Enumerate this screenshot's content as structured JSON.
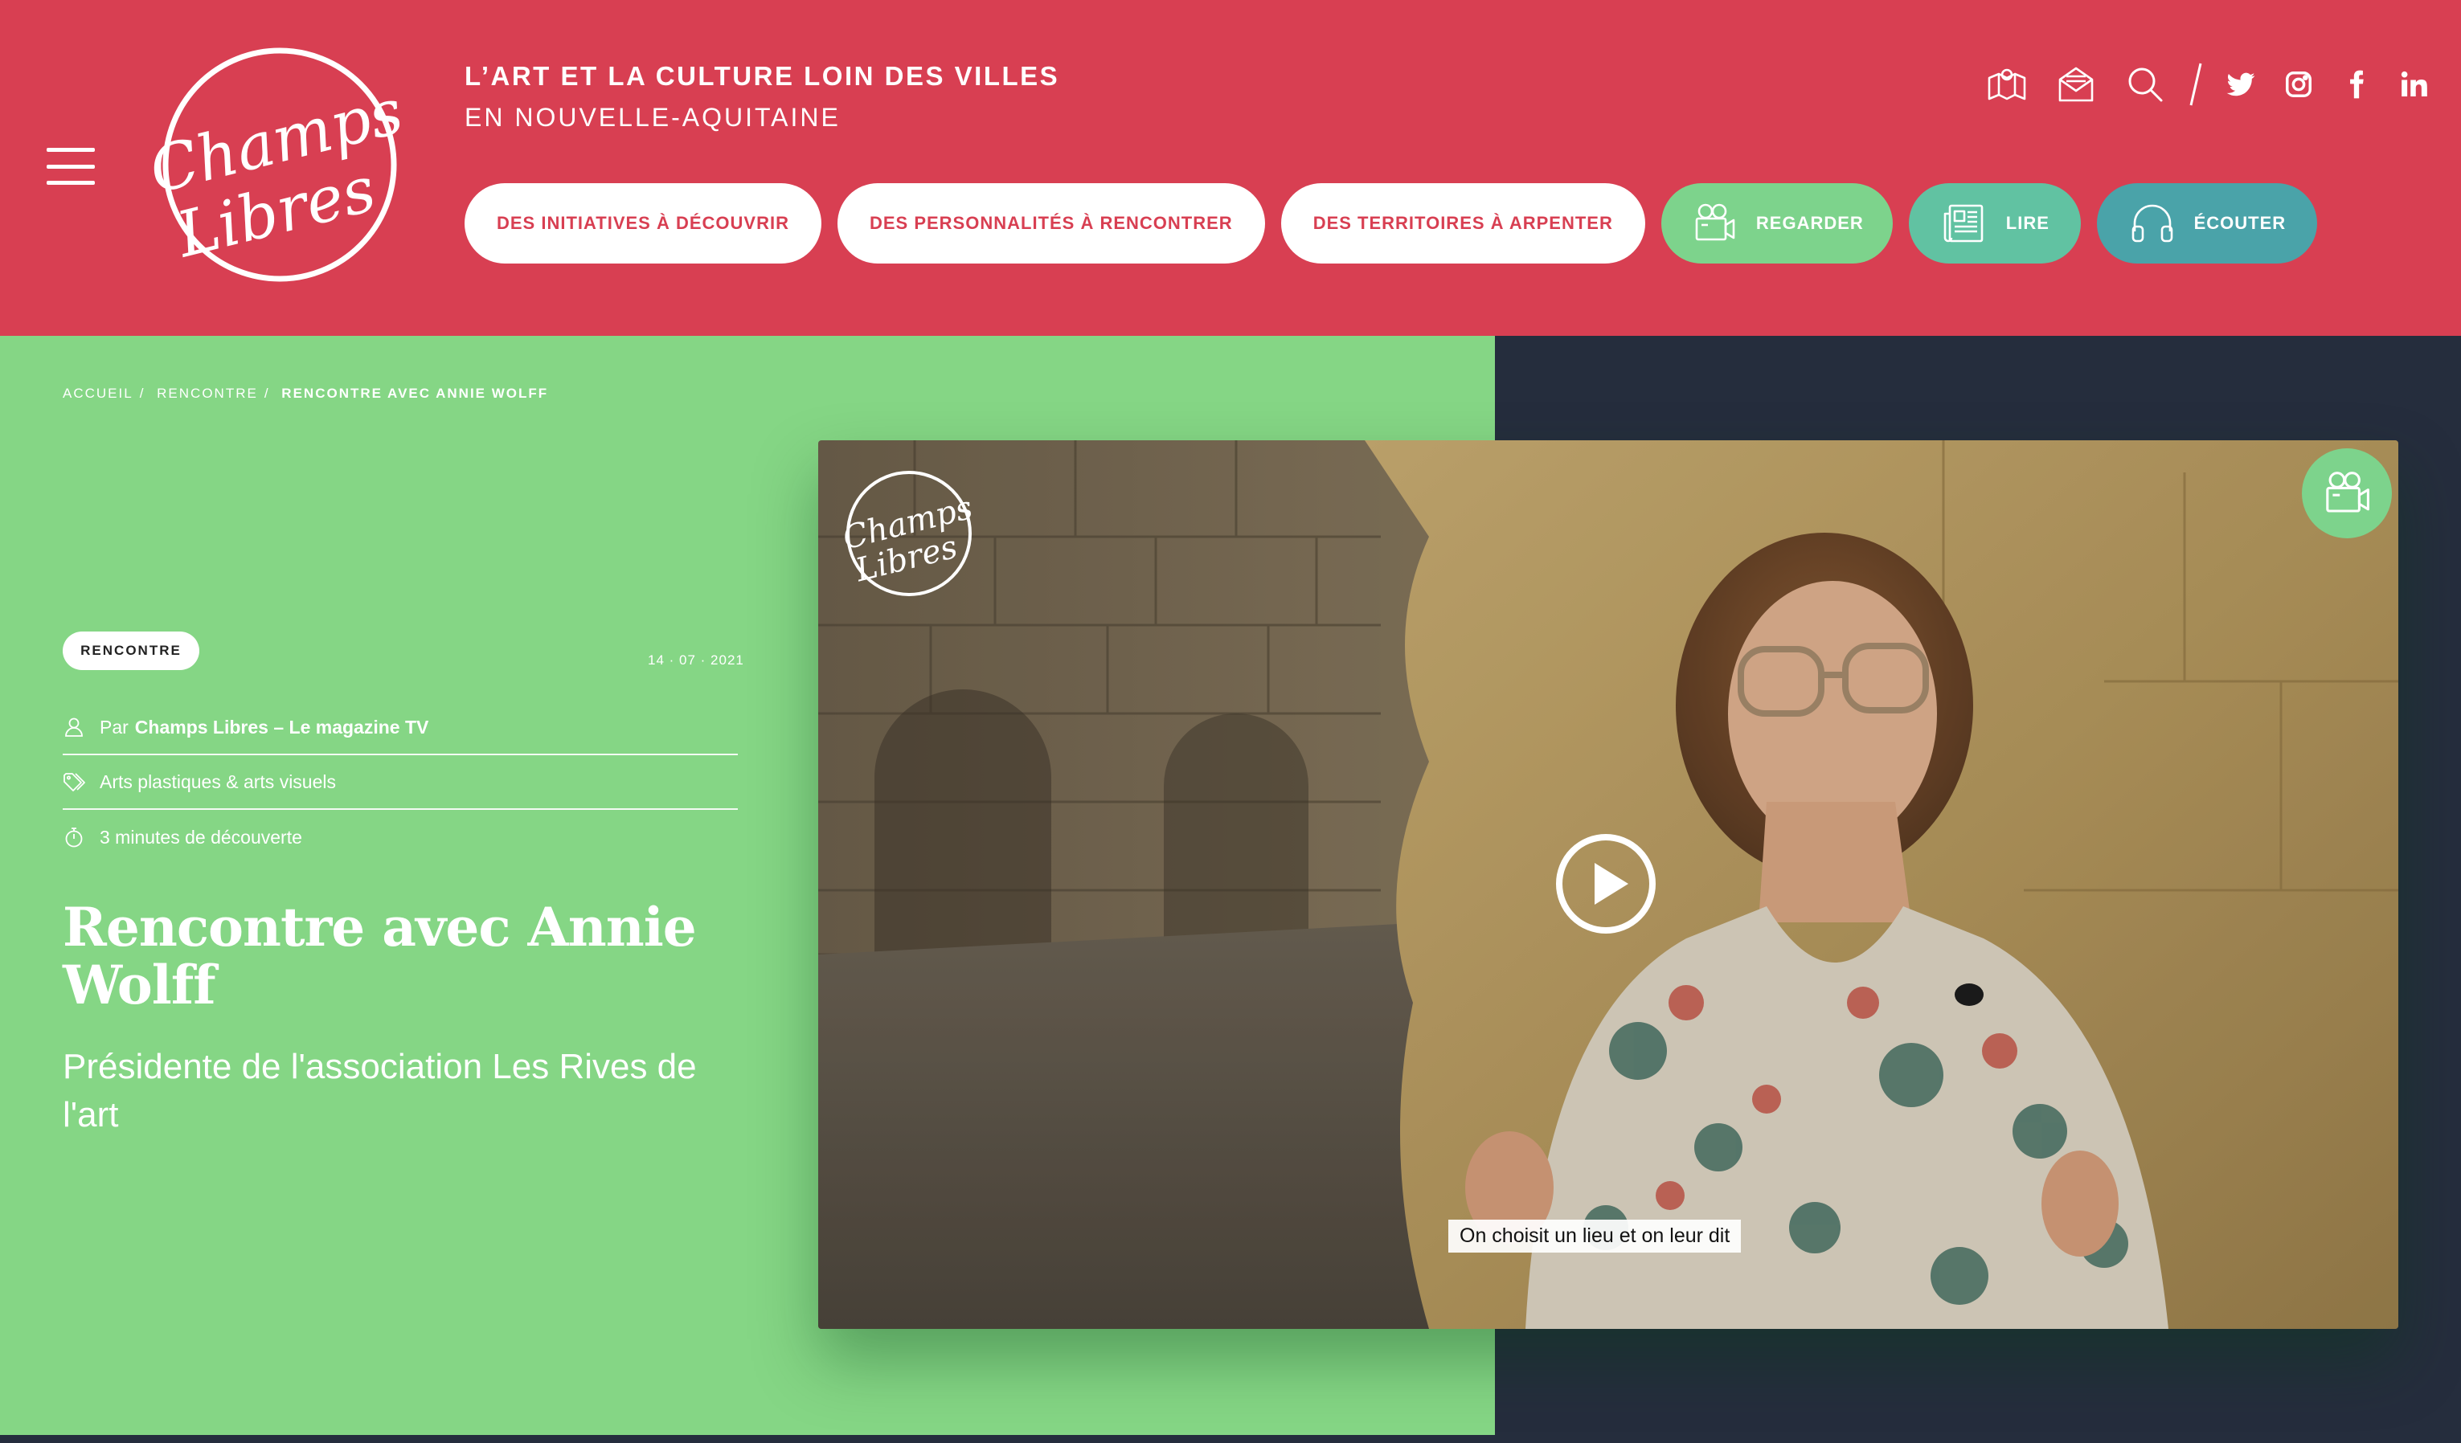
{
  "header": {
    "tagline_line1": "L’ART ET LA CULTURE LOIN DES VILLES",
    "tagline_line2": "EN NOUVELLE-AQUITAINE",
    "logo_text": "Champs Libres",
    "nav": [
      {
        "label": "DES INITIATIVES À DÉCOUVRIR"
      },
      {
        "label": "DES PERSONNALITÉS À RENCONTRER"
      },
      {
        "label": "DES TERRITOIRES À ARPENTER"
      },
      {
        "label": "REGARDER",
        "icon": "video-camera-icon"
      },
      {
        "label": "LIRE",
        "icon": "newspaper-icon"
      },
      {
        "label": "ÉCOUTER",
        "icon": "headphones-icon"
      }
    ],
    "icons": [
      "map-icon",
      "newsletter-icon",
      "search-icon",
      "twitter-icon",
      "instagram-icon",
      "facebook-icon",
      "linkedin-icon"
    ]
  },
  "breadcrumb": {
    "home": "ACCUEIL",
    "sep": "/",
    "section": "RENCONTRE",
    "current": "RENCONTRE AVEC ANNIE WOLFF"
  },
  "article": {
    "badge": "RENCONTRE",
    "date": "14 · 07 · 2021",
    "author_prefix": "Par",
    "author": "Champs Libres – Le magazine TV",
    "category": "Arts plastiques & arts visuels",
    "reading_time": "3 minutes de découverte",
    "title": "Rencontre avec Annie Wolff",
    "subtitle": "Présidente de l'association Les Rives de l'art"
  },
  "video": {
    "caption": "On choisit un lieu et on leur dit",
    "watermark": "Champs Libres"
  },
  "colors": {
    "header_bg": "#d83f52",
    "panel_green": "#85d685",
    "dark_bg": "#252d3d",
    "pill_green": "#7dd38c",
    "pill_teal": "#61c2a2",
    "pill_blue": "#4aa3a9"
  }
}
